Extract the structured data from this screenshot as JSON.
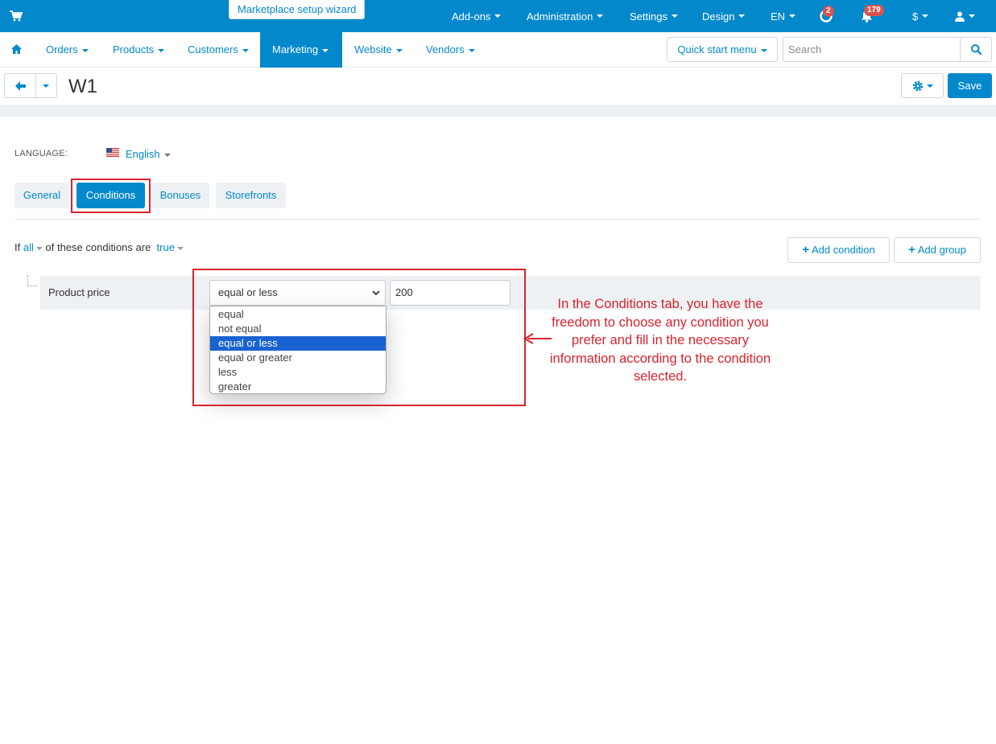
{
  "topbar": {
    "wizard": "Marketplace setup wizard",
    "menus": [
      {
        "label": "Add-ons"
      },
      {
        "label": "Administration"
      },
      {
        "label": "Settings"
      },
      {
        "label": "Design"
      },
      {
        "label": "EN"
      }
    ],
    "help_badge": "2",
    "notif_badge": "179",
    "currency": "$",
    "colors": {
      "primary": "#0388cc",
      "badge": "#d9534f"
    }
  },
  "mainnav": {
    "items": [
      {
        "label": "Orders"
      },
      {
        "label": "Products"
      },
      {
        "label": "Customers"
      },
      {
        "label": "Marketing"
      },
      {
        "label": "Website"
      },
      {
        "label": "Vendors"
      }
    ],
    "active": "Marketing",
    "quick_start": "Quick start menu",
    "search_placeholder": "Search"
  },
  "page": {
    "title": "W1",
    "save": "Save"
  },
  "language": {
    "label": "LANGUAGE:",
    "value": "English"
  },
  "tabs": [
    {
      "label": "General"
    },
    {
      "label": "Conditions"
    },
    {
      "label": "Bonuses"
    },
    {
      "label": "Storefronts"
    }
  ],
  "conditions": {
    "prefix": "If",
    "mode": "all",
    "middle": "of these conditions are",
    "state": "true",
    "add_condition": "Add condition",
    "add_group": "Add group",
    "row": {
      "name": "Product price",
      "operator": "equal or less",
      "value": "200"
    },
    "options": [
      "equal",
      "not equal",
      "equal or less",
      "equal or greater",
      "less",
      "greater"
    ]
  },
  "annotation": "In the Conditions tab, you have the freedom to choose any condition you prefer and fill in the necessary information according to the condition selected."
}
